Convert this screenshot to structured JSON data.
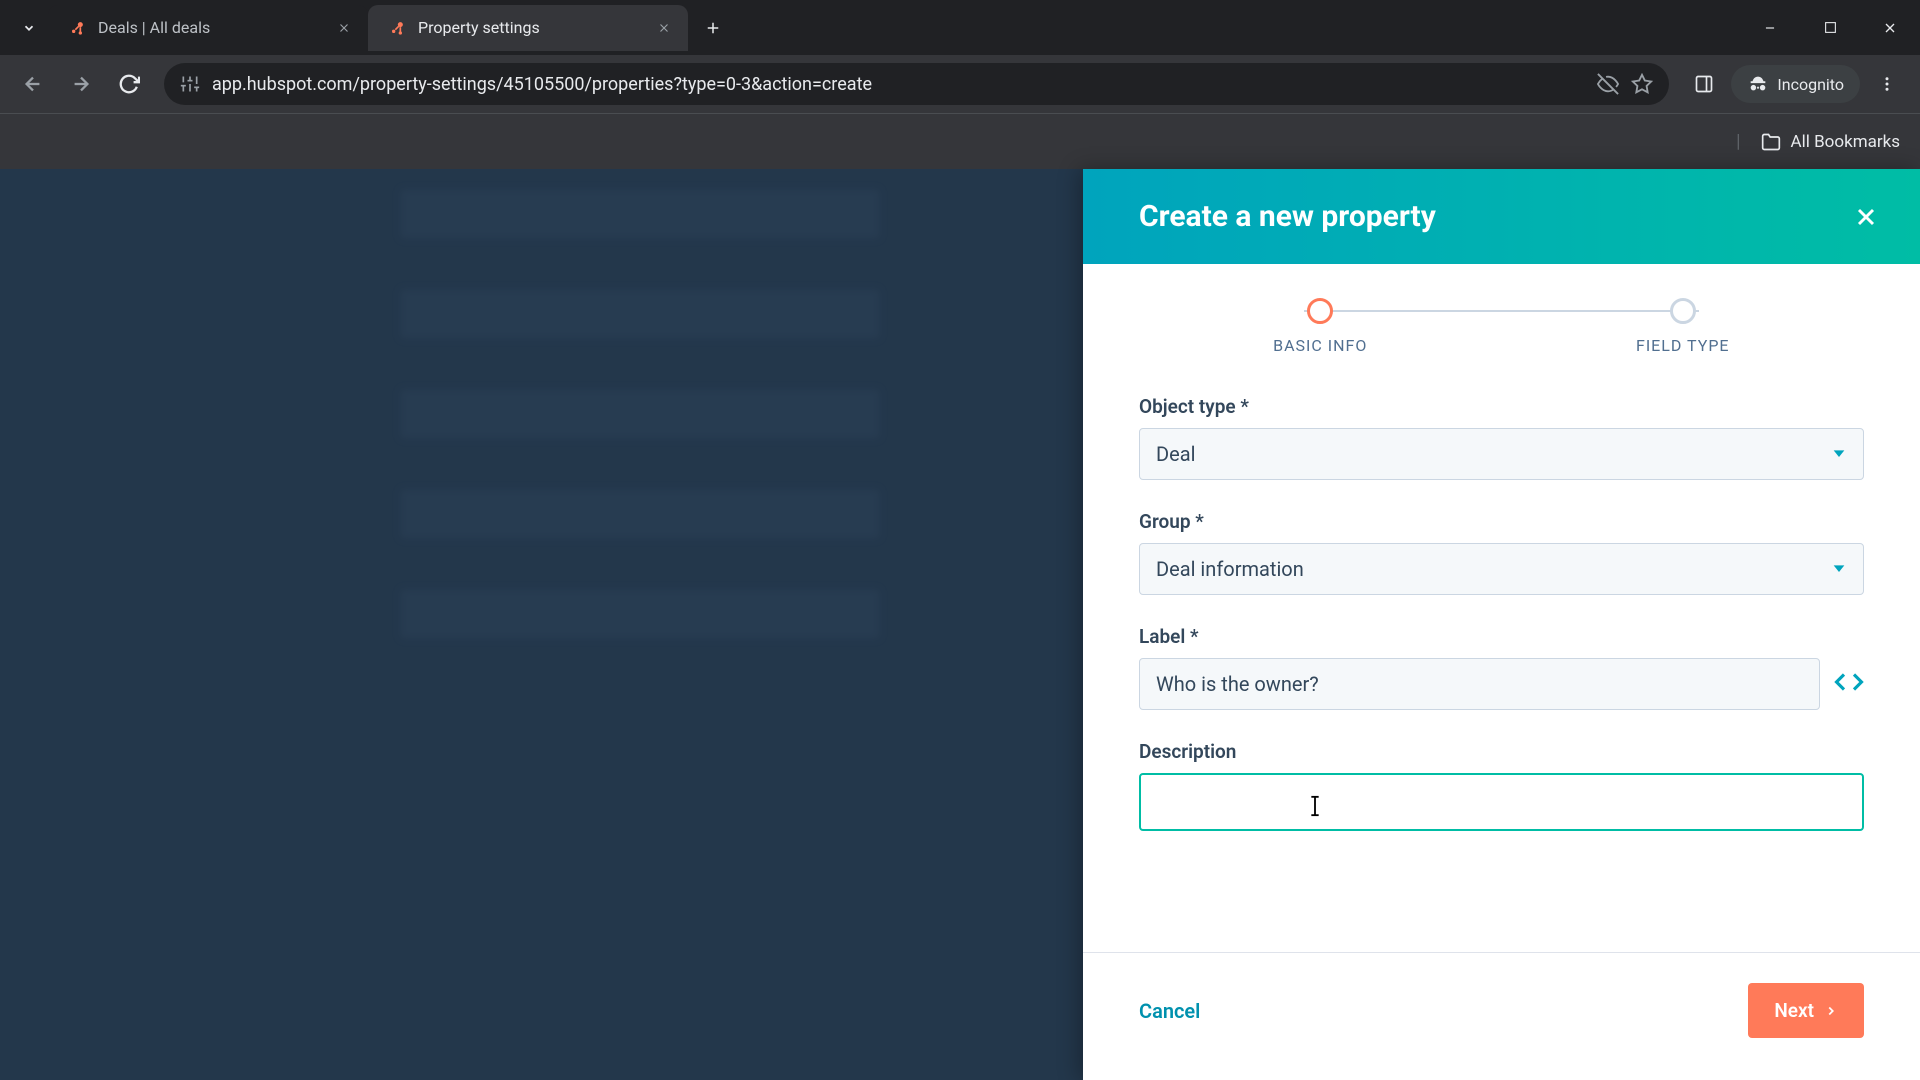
{
  "browser": {
    "tabs": [
      {
        "title": "Deals | All deals",
        "active": false
      },
      {
        "title": "Property settings",
        "active": true
      }
    ],
    "url": "app.hubspot.com/property-settings/45105500/properties?type=0-3&action=create",
    "incognito_label": "Incognito",
    "all_bookmarks_label": "All Bookmarks"
  },
  "panel": {
    "title": "Create a new property",
    "steps": [
      {
        "label": "BASIC INFO",
        "active": true
      },
      {
        "label": "FIELD TYPE",
        "active": false
      }
    ],
    "form": {
      "object_type": {
        "label": "Object type *",
        "value": "Deal"
      },
      "group": {
        "label": "Group *",
        "value": "Deal information"
      },
      "label_field": {
        "label": "Label *",
        "value": "Who is the owner?"
      },
      "description": {
        "label": "Description",
        "value": ""
      }
    },
    "footer": {
      "cancel": "Cancel",
      "next": "Next"
    }
  }
}
